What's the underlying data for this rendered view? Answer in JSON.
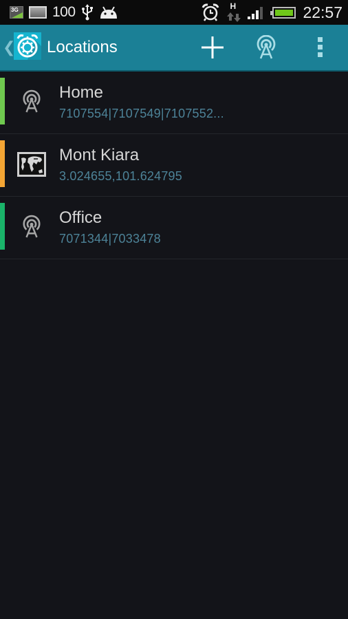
{
  "status_bar": {
    "left_icons": [
      "3g-data-icon",
      "gallery-icon",
      "usb-icon",
      "android-debug-icon"
    ],
    "notification_count": "100",
    "right_icons": [
      "alarm-icon",
      "hspa-data-icon",
      "signal-icon",
      "battery-icon"
    ],
    "network_type": "H",
    "battery_color": "#6fc61a",
    "time": "22:57"
  },
  "action_bar": {
    "title": "Locations",
    "background_color": "#1b8096",
    "actions": [
      {
        "name": "add",
        "icon": "plus-icon"
      },
      {
        "name": "cell-tower",
        "icon": "cell-tower-icon"
      },
      {
        "name": "overflow-menu",
        "icon": "overflow-menu-icon"
      }
    ]
  },
  "locations": [
    {
      "name": "Home",
      "detail": "7107554|7107549|7107552...",
      "type": "cell-tower",
      "color": "#6fc94f"
    },
    {
      "name": "Mont Kiara",
      "detail": "3.024655,101.624795",
      "type": "map",
      "color": "#f4a534"
    },
    {
      "name": "Office",
      "detail": "7071344|7033478",
      "type": "cell-tower",
      "color": "#1ab46a"
    }
  ]
}
